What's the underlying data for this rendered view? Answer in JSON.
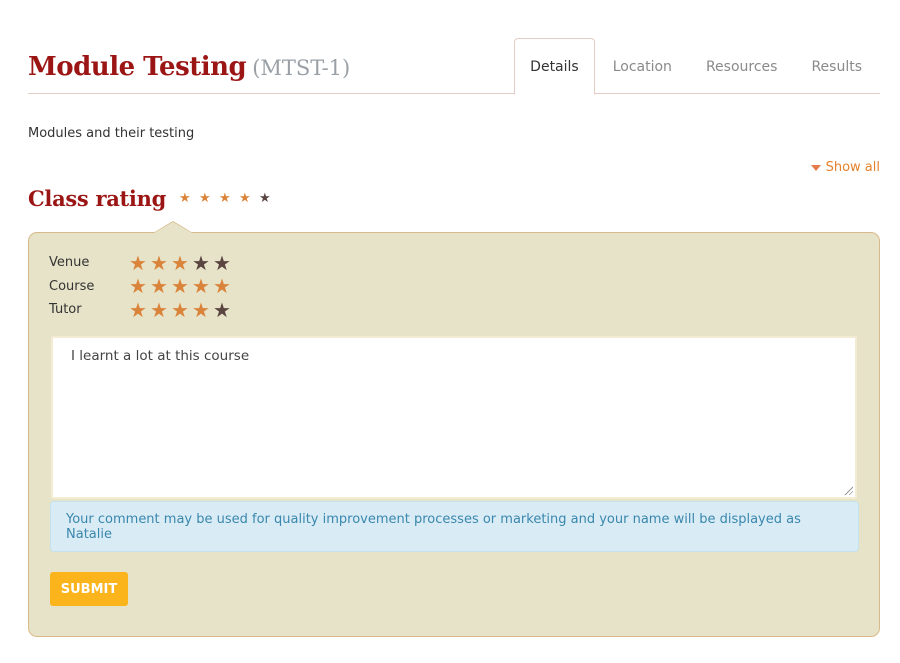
{
  "header": {
    "title": "Module Testing",
    "code": "(MTST-1)",
    "tabs": [
      {
        "label": "Details",
        "active": true
      },
      {
        "label": "Location",
        "active": false
      },
      {
        "label": "Resources",
        "active": false
      },
      {
        "label": "Results",
        "active": false
      }
    ]
  },
  "description": "Modules and their testing",
  "show_all": {
    "label": "Show all",
    "icon": "caret-down-icon"
  },
  "class_rating": {
    "title": "Class rating",
    "overall_stars": 4,
    "max_stars": 5,
    "star_glyph": "★"
  },
  "ratings": [
    {
      "label": "Venue",
      "stars": 3,
      "max": 5
    },
    {
      "label": "Course",
      "stars": 5,
      "max": 5
    },
    {
      "label": "Tutor",
      "stars": 4,
      "max": 5
    }
  ],
  "comment": {
    "value": "I learnt a lot at this course"
  },
  "notice": "Your comment may be used for quality improvement processes or marketing and your name will be displayed as Natalie",
  "submit_label": "SUBMIT",
  "colors": {
    "brand": "#9b1515",
    "star_on": "#d9843a",
    "star_off": "#5a4541",
    "link": "#e5812b",
    "panel_bg": "#e7e3c8",
    "notice_bg": "#d9ecf6",
    "notice_text": "#3a87ad",
    "submit_bg": "#fbb41c"
  }
}
